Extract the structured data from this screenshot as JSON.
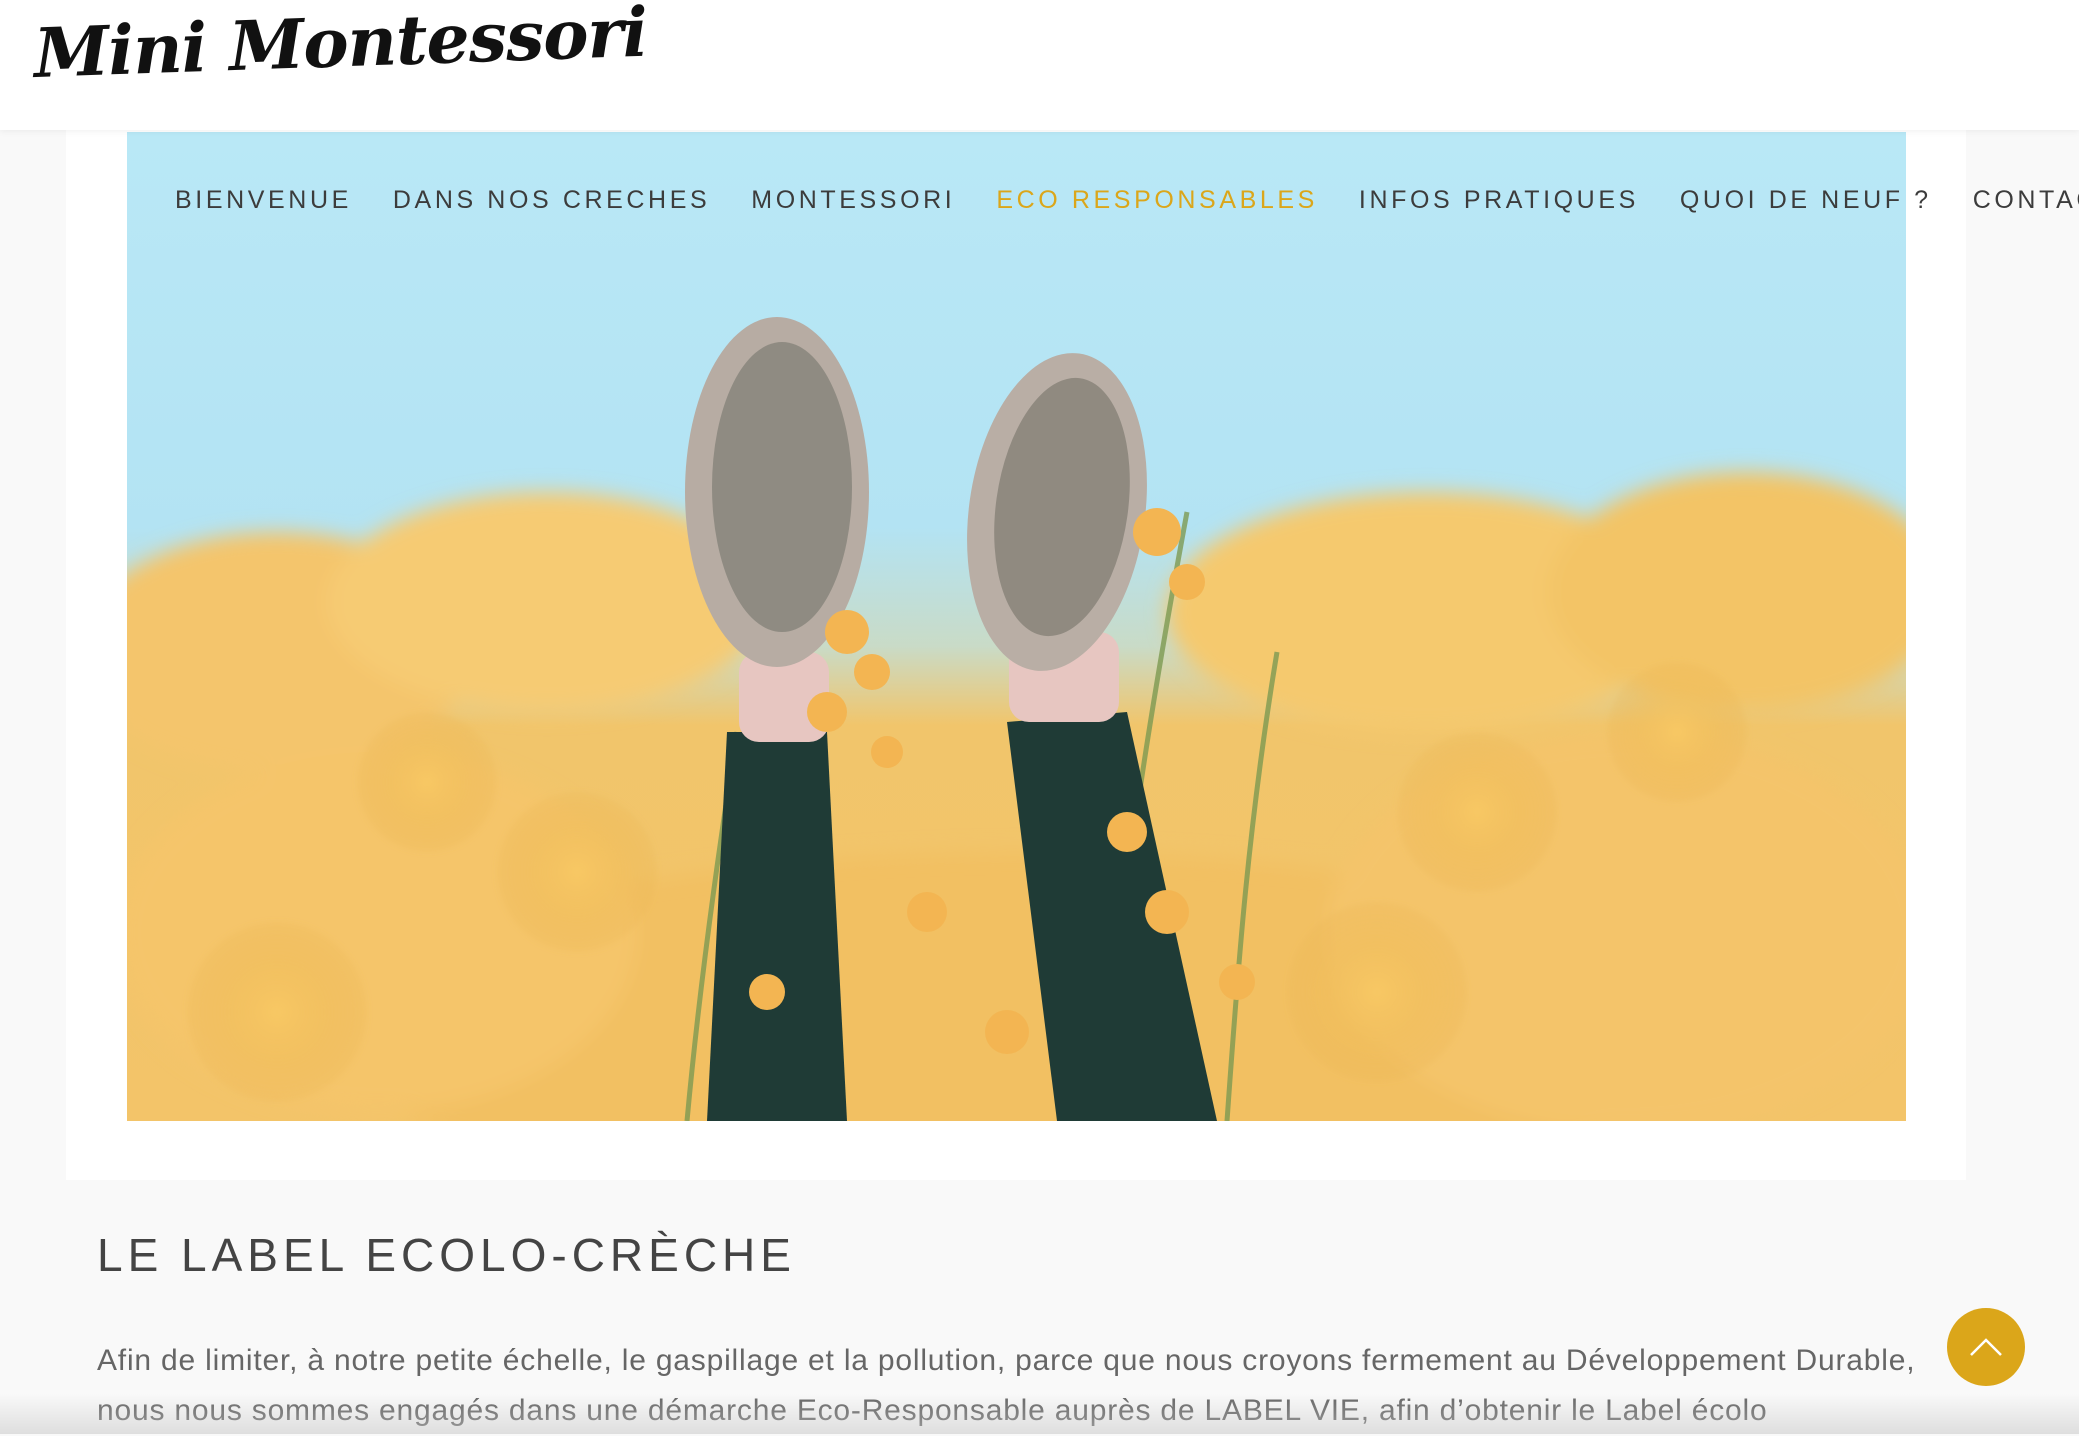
{
  "header": {
    "logo_text": "Mini Montessori"
  },
  "nav": {
    "items": [
      {
        "label": "BIENVENUE"
      },
      {
        "label": "DANS NOS CRECHES"
      },
      {
        "label": "MONTESSORI"
      },
      {
        "label": "ECO RESPONSABLES",
        "active": true
      },
      {
        "label": "INFOS PRATIQUES"
      },
      {
        "label": "QUOI DE NEUF ?"
      },
      {
        "label": "CONTACT"
      }
    ]
  },
  "hero": {
    "icon": "hero-photo-icon"
  },
  "section": {
    "title": "LE LABEL ECOLO-CRÈCHE",
    "paragraph": "Afin de limiter, à notre petite échelle, le gaspillage et la pollution, parce que nous croyons fermement au Développement Durable, nous nous sommes engagés dans une démarche Eco-Responsable auprès de LABEL VIE, afin d’obtenir le Label écolo"
  },
  "scroll_top": {
    "icon": "chevron-up-icon"
  },
  "colors": {
    "accent": "#dba61a",
    "nav_text": "#3c3c3c",
    "body_text": "#666666",
    "background": "#f9f9f9"
  }
}
